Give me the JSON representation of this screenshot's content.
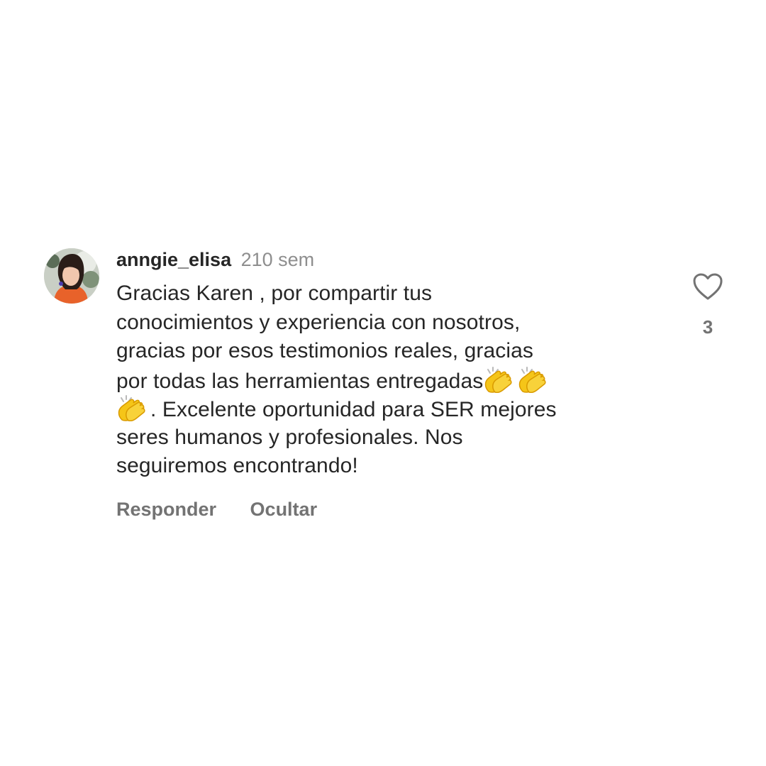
{
  "comment": {
    "username": "anngie_elisa",
    "time": "210 sem",
    "lines": [
      "Gracias Karen , por compartir tus",
      "conocimientos y experiencia con nosotros,",
      "gracias por esos testimonios reales, gracias",
      "por todas las herramientas entregadas",
      ". Excelente oportunidad para SER mejores",
      "seres humanos y profesionales. Nos",
      "seguiremos encontrando!"
    ],
    "reply_label": "Responder",
    "hide_label": "Ocultar",
    "like_count": "3",
    "icons": {
      "like": "heart-outline-icon",
      "emoji": "clapping-hands-emoji"
    },
    "colors": {
      "text": "#262626",
      "secondary": "#8e8e8e",
      "action": "#737373",
      "emoji": "#f5c518"
    }
  }
}
